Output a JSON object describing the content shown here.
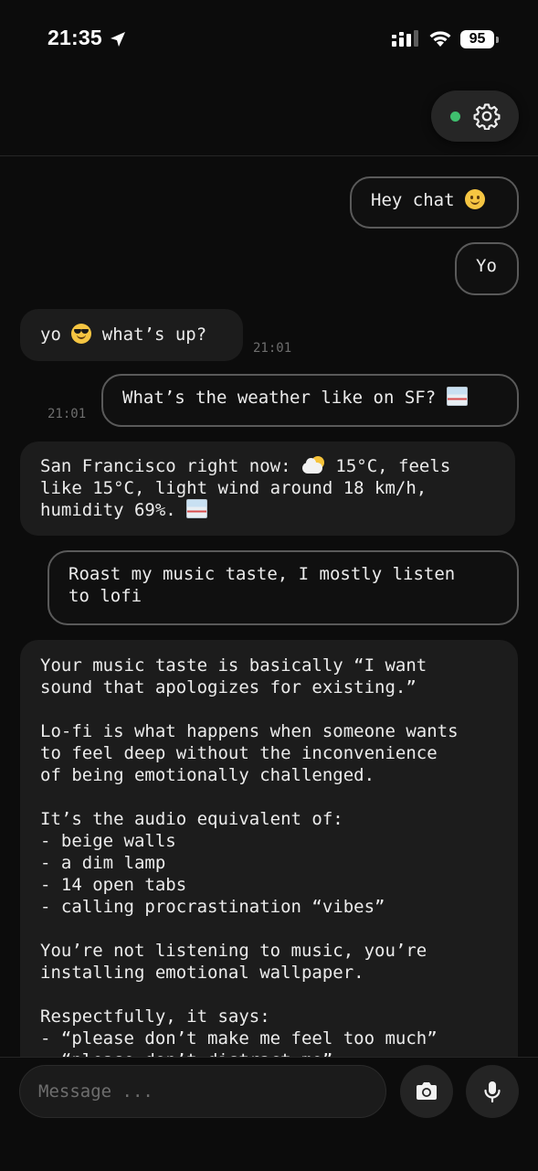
{
  "status_bar": {
    "time": "21:35",
    "battery": "95",
    "icons": [
      "location-arrow-icon",
      "signal-icon",
      "wifi-icon",
      "battery-icon"
    ]
  },
  "header": {
    "connection_status": "online",
    "status_color": "#3fbf6e",
    "settings_icon": "gear-icon"
  },
  "messages": [
    {
      "role": "user",
      "text": "Hey chat ",
      "emoji": "slightly-smiling-face"
    },
    {
      "role": "user",
      "text": "Yo"
    },
    {
      "role": "assistant",
      "text_before": "yo ",
      "emoji": "sunglasses-face",
      "text_after": " what’s up?",
      "time": "21:01"
    },
    {
      "role": "user",
      "text": "What’s the weather like on SF? ",
      "emoji": "image-icon",
      "time": "21:01"
    },
    {
      "role": "assistant",
      "text_line1a": "San Francisco right now: ",
      "emoji1": "sun-behind-cloud",
      "text_line1b": " 15°C, feels",
      "text_rest": "like 15°C, light wind around 18 km/h,\nhumidity 69%. ",
      "emoji2": "image-icon"
    },
    {
      "role": "user",
      "text": "Roast my music taste, I mostly listen\nto lofi"
    },
    {
      "role": "assistant",
      "text": "Your music taste is basically “I want\nsound that apologizes for existing.”\n\nLo-fi is what happens when someone wants\nto feel deep without the inconvenience\nof being emotionally challenged.\n\nIt’s the audio equivalent of:\n- beige walls\n- a dim lamp\n- 14 open tabs\n- calling procrastination “vibes”\n\nYou’re not listening to music, you’re\ninstalling emotional wallpaper.\n\nRespectfully, it says:\n- “please don’t make me feel too much”\n- “please don’t distract me”"
    }
  ],
  "composer": {
    "placeholder": "Message ...",
    "camera_icon": "camera-icon",
    "mic_icon": "microphone-icon"
  },
  "colors": {
    "background": "#0c0c0c",
    "assistant_bubble": "#1c1c1c",
    "user_bubble_border": "#5a5a5a",
    "timestamp": "#6e6e6e"
  }
}
